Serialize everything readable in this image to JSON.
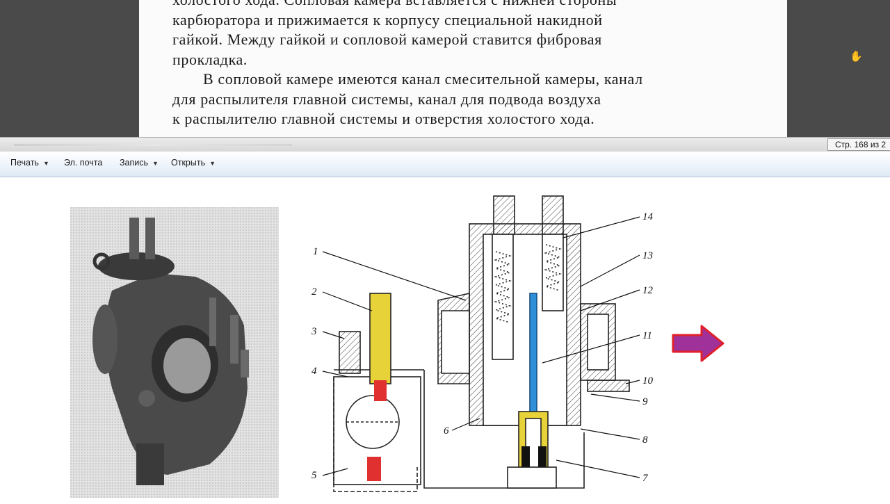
{
  "document": {
    "lines": [
      "холостого хода. Сопловая камера вставляется с нижней стороны",
      "карбюратора и прижимается к корпусу специальной накидной",
      "гайкой. Между гайкой и сопловой камерой ставится фибровая",
      "прокладка.",
      "В сопловой камере имеются канал смесительной камеры, канал",
      "для распылителя главной системы, канал для подвода воздуха",
      "к распылителю главной системы и отверстия холостого хода."
    ]
  },
  "statusbar": {
    "page_counter": "Стр. 168 из 2"
  },
  "toolbar": {
    "print_label": "Печать",
    "email_label": "Эл. почта",
    "record_label": "Запись",
    "open_label": "Открыть"
  },
  "figure": {
    "callouts": [
      "1",
      "2",
      "3",
      "4",
      "5",
      "6",
      "7",
      "8",
      "9",
      "10",
      "11",
      "12",
      "13",
      "14"
    ]
  },
  "colors": {
    "accent_arrow": "#a0309a",
    "arrow_outline": "#e0202a",
    "needle": "#2f8fd8",
    "brass": "#e8d23a",
    "rubber_tip": "#e03030"
  }
}
